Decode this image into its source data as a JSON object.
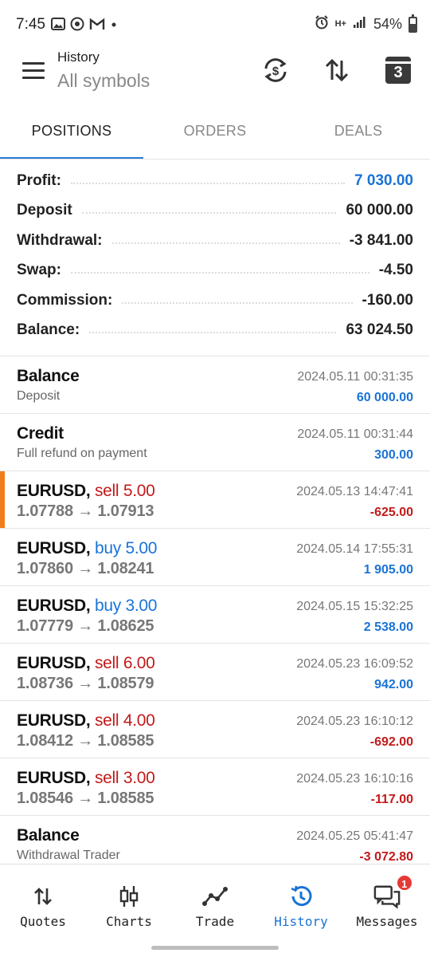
{
  "status_bar": {
    "time": "7:45",
    "network": "H+",
    "battery": "54%"
  },
  "header": {
    "title": "History",
    "subtitle": "All symbols",
    "calendar_day": "3"
  },
  "tabs": [
    {
      "label": "POSITIONS",
      "active": true
    },
    {
      "label": "ORDERS",
      "active": false
    },
    {
      "label": "DEALS",
      "active": false
    }
  ],
  "summary": [
    {
      "label": "Profit:",
      "value": "7 030.00"
    },
    {
      "label": "Deposit",
      "value": "60 000.00"
    },
    {
      "label": "Withdrawal:",
      "value": "-3 841.00"
    },
    {
      "label": "Swap:",
      "value": "-4.50"
    },
    {
      "label": "Commission:",
      "value": "-160.00"
    },
    {
      "label": "Balance:",
      "value": "63 024.50"
    }
  ],
  "items": [
    {
      "title": "Balance",
      "detail": "Deposit",
      "time": "2024.05.11 00:31:35",
      "profit": "60 000.00"
    },
    {
      "title": "Credit",
      "detail": "Full refund on payment",
      "time": "2024.05.11 00:31:44",
      "profit": "300.00"
    },
    {
      "symbol": "EURUSD,",
      "side": "sell 5.00",
      "prices": "1.07788 → 1.07913",
      "time": "2024.05.13 14:47:41",
      "profit": "-625.00"
    },
    {
      "symbol": "EURUSD,",
      "side": "buy 5.00",
      "prices": "1.07860 → 1.08241",
      "time": "2024.05.14 17:55:31",
      "profit": "1 905.00"
    },
    {
      "symbol": "EURUSD,",
      "side": "buy 3.00",
      "prices": "1.07779 → 1.08625",
      "time": "2024.05.15 15:32:25",
      "profit": "2 538.00"
    },
    {
      "symbol": "EURUSD,",
      "side": "sell 6.00",
      "prices": "1.08736 → 1.08579",
      "time": "2024.05.23 16:09:52",
      "profit": "942.00"
    },
    {
      "symbol": "EURUSD,",
      "side": "sell 4.00",
      "prices": "1.08412 → 1.08585",
      "time": "2024.05.23 16:10:12",
      "profit": "-692.00"
    },
    {
      "symbol": "EURUSD,",
      "side": "sell 3.00",
      "prices": "1.08546 → 1.08585",
      "time": "2024.05.23 16:10:16",
      "profit": "-117.00"
    },
    {
      "title": "Balance",
      "detail": "Withdrawal Trader",
      "time": "2024.05.25 05:41:47",
      "profit": "-3 072.80"
    }
  ],
  "bottom_nav": [
    {
      "label": "Quotes",
      "icon": "arrows-updown-icon"
    },
    {
      "label": "Charts",
      "icon": "candlestick-icon"
    },
    {
      "label": "Trade",
      "icon": "trend-line-icon"
    },
    {
      "label": "History",
      "icon": "history-clock-icon",
      "active": true
    },
    {
      "label": "Messages",
      "icon": "chat-bubbles-icon",
      "badge": "1"
    }
  ],
  "colors": {
    "accent_blue": "#1a73d6",
    "sell_red": "#c21a1a",
    "marker_orange": "#f07d1a"
  }
}
